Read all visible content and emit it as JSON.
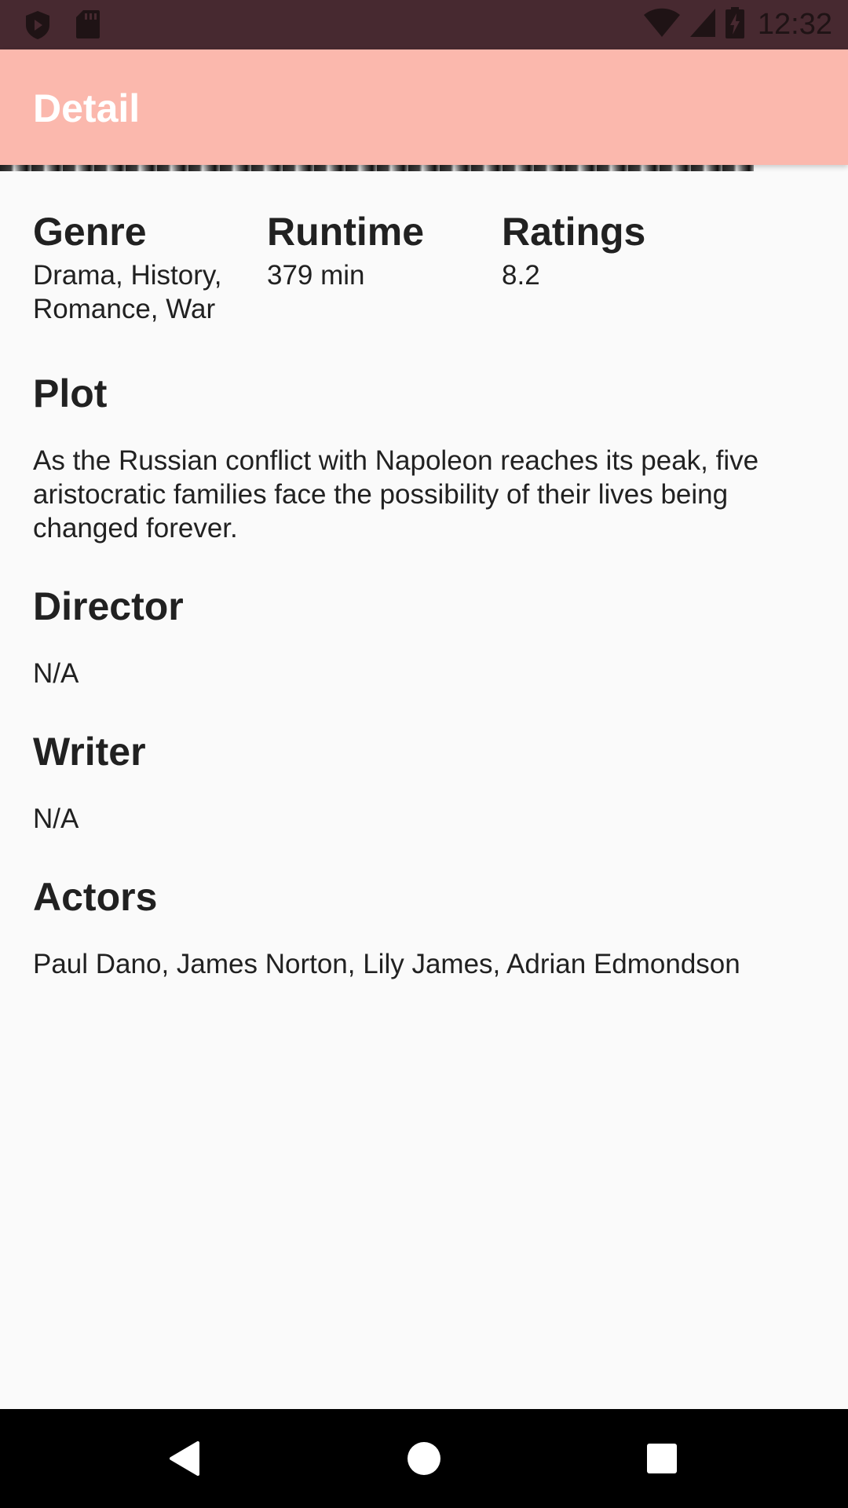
{
  "status_bar": {
    "time": "12:32",
    "icons": [
      "shield-icon",
      "sd-card-icon",
      "wifi-icon",
      "signal-icon",
      "battery-charging-icon"
    ]
  },
  "app_bar": {
    "title": "Detail",
    "color": "#fbb8ad"
  },
  "details": {
    "genre": {
      "label": "Genre",
      "value": "Drama, History, Romance, War"
    },
    "runtime": {
      "label": "Runtime",
      "value": "379 min"
    },
    "ratings": {
      "label": "Ratings",
      "value": "8.2"
    },
    "plot": {
      "label": "Plot",
      "value": "As the Russian conflict with Napoleon reaches its peak, five aristocratic families face the possibility of their lives being changed forever."
    },
    "director": {
      "label": "Director",
      "value": "N/A"
    },
    "writer": {
      "label": "Writer",
      "value": "N/A"
    },
    "actors": {
      "label": "Actors",
      "value": "Paul Dano, James Norton, Lily James, Adrian Edmondson"
    }
  },
  "nav_bar": {
    "icons": [
      "back-icon",
      "home-icon",
      "recents-icon"
    ]
  }
}
